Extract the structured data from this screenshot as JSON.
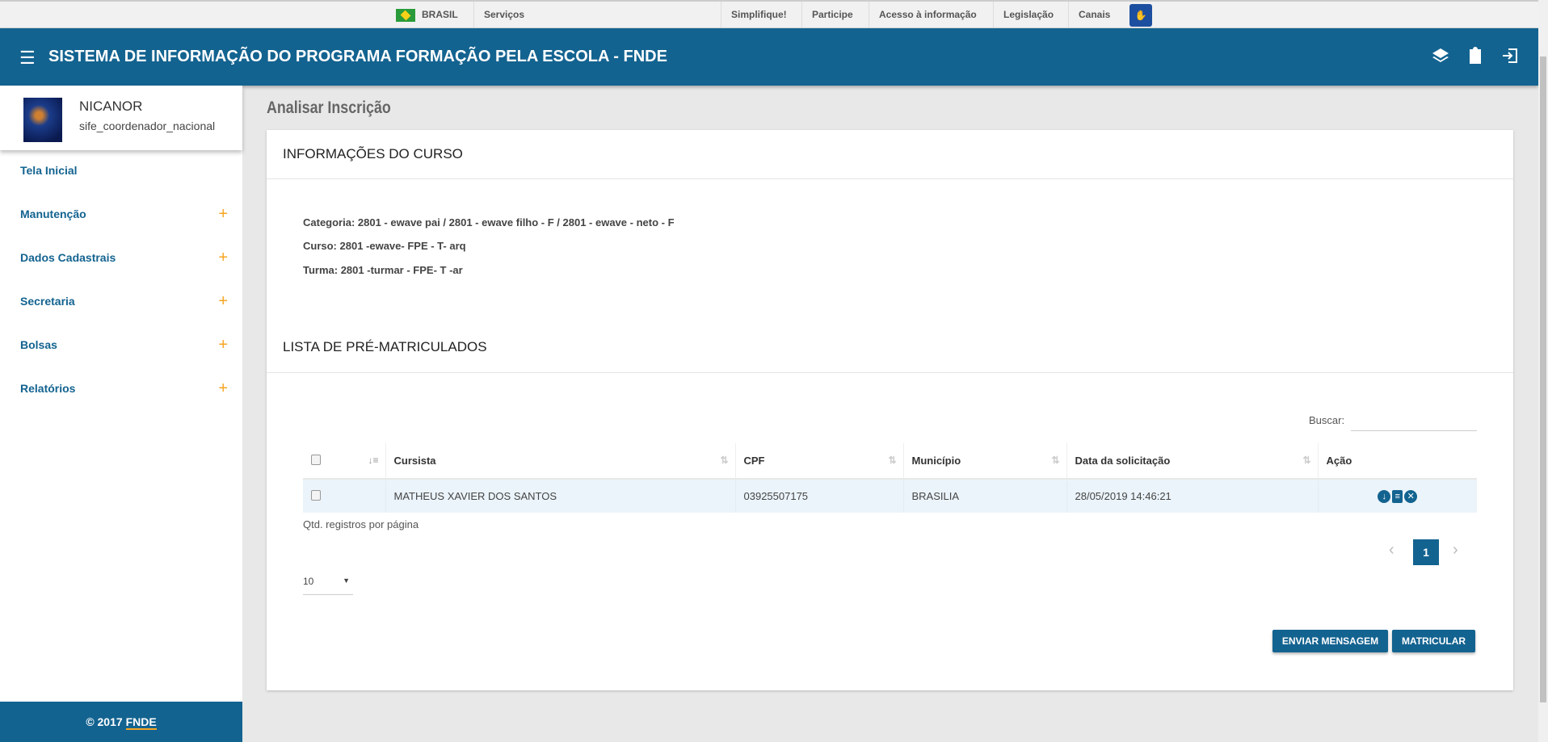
{
  "govbar": {
    "country": "BRASIL",
    "services": "Serviços",
    "links": [
      "Simplifique!",
      "Participe",
      "Acesso à informação",
      "Legislação",
      "Canais"
    ]
  },
  "header": {
    "title": "SISTEMA DE INFORMAÇÃO DO PROGRAMA FORMAÇÃO PELA ESCOLA - FNDE"
  },
  "user": {
    "name": "NICANOR",
    "role": "sife_coordenador_nacional"
  },
  "sidebar": {
    "items": [
      {
        "label": "Tela Inicial"
      },
      {
        "label": "Manutenção",
        "expand": "+"
      },
      {
        "label": "Dados Cadastrais",
        "expand": "+"
      },
      {
        "label": "Secretaria",
        "expand": "+"
      },
      {
        "label": "Bolsas",
        "expand": "+"
      },
      {
        "label": "Relatórios",
        "expand": "+"
      }
    ]
  },
  "footer": {
    "copyright": "© 2017",
    "brand": "FNDE"
  },
  "page": {
    "title": "Analisar Inscrição"
  },
  "course": {
    "heading": "INFORMAÇÕES DO CURSO",
    "categoria": "Categoria: 2801 - ewave pai / 2801 - ewave filho - F / 2801 - ewave - neto - F",
    "curso": "Curso: 2801 -ewave- FPE - T- arq",
    "turma": "Turma: 2801 -turmar - FPE- T -ar"
  },
  "list": {
    "heading": "LISTA DE PRÉ-MATRICULADOS",
    "search_label": "Buscar:",
    "search_value": "",
    "columns": [
      "Cursista",
      "CPF",
      "Município",
      "Data da solicitação",
      "Ação"
    ],
    "rows": [
      {
        "cursista": "MATHEUS XAVIER DOS SANTOS",
        "cpf": "03925507175",
        "municipio": "BRASILIA",
        "data": "28/05/2019 14:46:21"
      }
    ],
    "per_page_label": "Qtd. registros por página",
    "per_page": "10",
    "current_page": "1"
  },
  "buttons": {
    "send": "ENVIAR MENSAGEM",
    "enroll": "MATRICULAR"
  },
  "colors": {
    "primary": "#136390",
    "accent": "#f5a623"
  }
}
